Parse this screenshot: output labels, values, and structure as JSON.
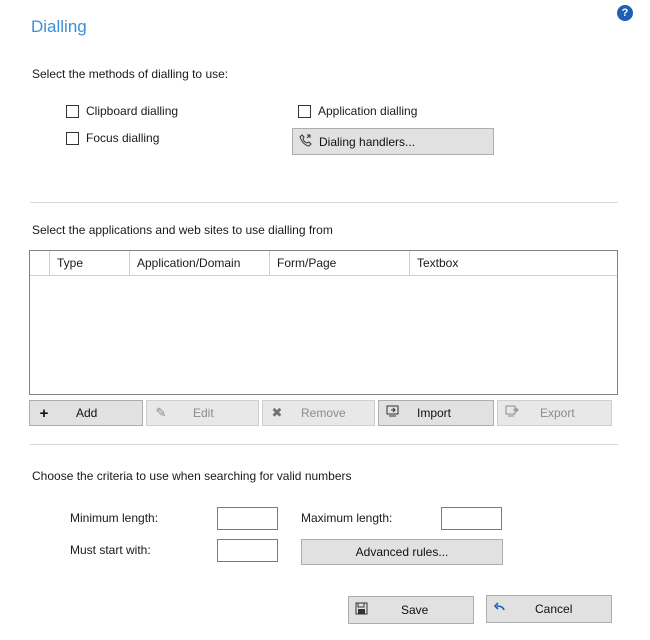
{
  "window": {
    "title": "Dialling",
    "help_icon": "?"
  },
  "methods": {
    "heading": "Select the methods of dialling to use:",
    "clipboard_label": "Clipboard dialling",
    "application_label": "Application dialling",
    "focus_label": "Focus dialling",
    "dialing_handlers_label": "Dialing handlers..."
  },
  "apps": {
    "heading": "Select the applications and web sites to use dialling from",
    "columns": [
      "Type",
      "Application/Domain",
      "Form/Page",
      "Textbox"
    ],
    "rows": []
  },
  "toolbar": {
    "add_label": "Add",
    "edit_label": "Edit",
    "remove_label": "Remove",
    "import_label": "Import",
    "export_label": "Export"
  },
  "criteria": {
    "heading": "Choose the criteria to use when searching for valid numbers",
    "min_length_label": "Minimum length:",
    "max_length_label": "Maximum length:",
    "must_start_label": "Must start with:",
    "min_length_value": "",
    "max_length_value": "",
    "must_start_value": "",
    "advanced_rules_label": "Advanced rules..."
  },
  "footer": {
    "save_label": "Save",
    "cancel_label": "Cancel"
  },
  "colors": {
    "title": "#3c8fd6",
    "help_icon_bg": "#1f5fb4",
    "button_bg": "#e1e1e1"
  }
}
